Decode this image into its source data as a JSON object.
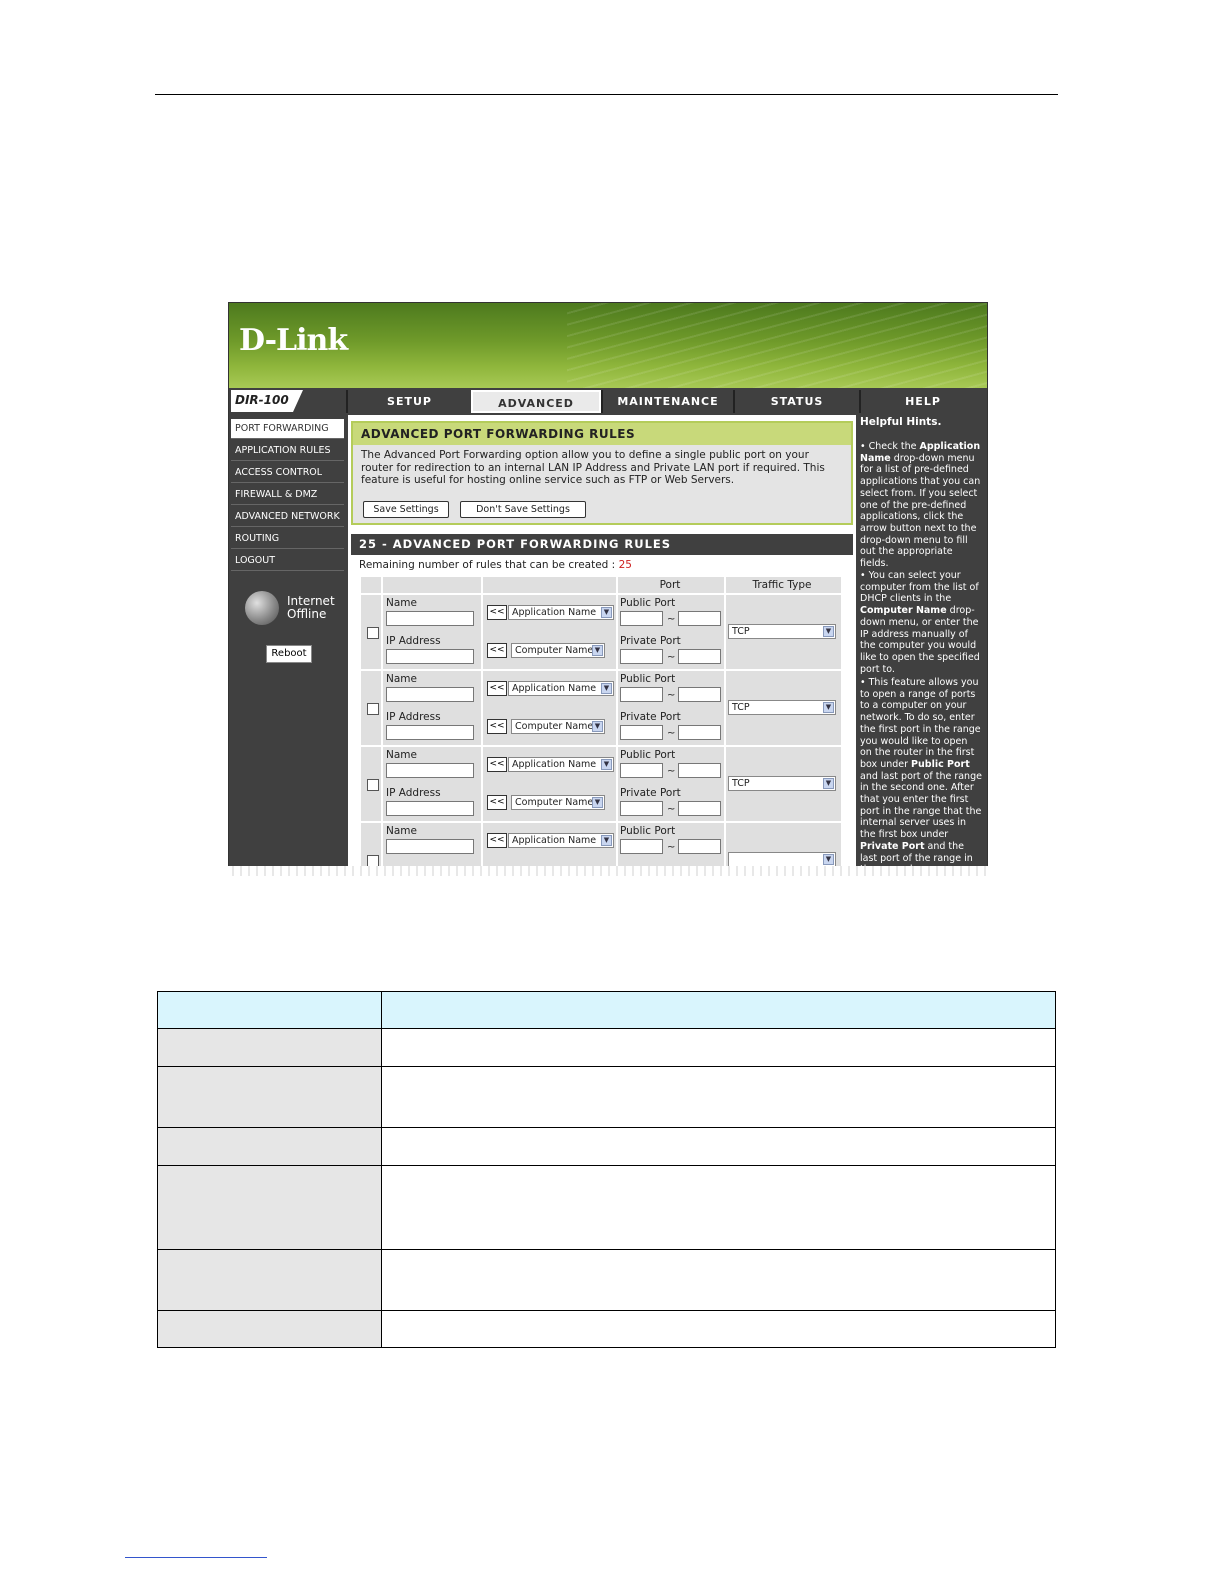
{
  "brand": {
    "logo": "D-Link",
    "model": "DIR-100"
  },
  "nav": {
    "tabs": [
      {
        "label": "SETUP"
      },
      {
        "label": "ADVANCED"
      },
      {
        "label": "MAINTENANCE"
      },
      {
        "label": "STATUS"
      },
      {
        "label": "HELP"
      }
    ],
    "active": "ADVANCED"
  },
  "sidebar": {
    "items": [
      {
        "label": "PORT FORWARDING"
      },
      {
        "label": "APPLICATION RULES"
      },
      {
        "label": "ACCESS CONTROL"
      },
      {
        "label": "FIREWALL & DMZ"
      },
      {
        "label": "ADVANCED NETWORK"
      },
      {
        "label": "ROUTING"
      },
      {
        "label": "LOGOUT"
      }
    ],
    "status_line1": "Internet",
    "status_line2": "Offline",
    "reboot_label": "Reboot"
  },
  "intro": {
    "title": "ADVANCED PORT FORWARDING RULES",
    "description": "The Advanced Port Forwarding option allow you to define a single public port on your router for redirection to an internal LAN IP Address and Private LAN port if required. This feature is useful for hosting online service such as FTP or Web Servers.",
    "save_label": "Save Settings",
    "dont_save_label": "Don't Save Settings"
  },
  "rules": {
    "title": "25 - ADVANCED PORT FORWARDING RULES",
    "remaining_label": "Remaining number of rules that can be created :",
    "remaining_count": "25",
    "headers": {
      "port": "Port",
      "traffic_type": "Traffic Type"
    },
    "labels": {
      "name": "Name",
      "ip_address": "IP Address",
      "public_port": "Public Port",
      "private_port": "Private Port",
      "arrow": "<<",
      "tilde": "~",
      "application_name": "Application Name",
      "computer_name": "Computer Name"
    },
    "rows": [
      {
        "traffic": "TCP"
      },
      {
        "traffic": "TCP"
      },
      {
        "traffic": "TCP"
      },
      {
        "traffic": ""
      }
    ]
  },
  "hints": {
    "title": "Helpful Hints.",
    "hint1_pre": "• Check the ",
    "hint1_bold": "Application Name",
    "hint1_post": " drop-down menu for a list of pre-defined applications that you can select from. If you select one of the pre-defined applications, click the arrow button next to the drop-down menu to fill out the appropriate fields.",
    "hint2_pre": "• You can select your computer from the list of DHCP clients in the ",
    "hint2_bold": "Computer Name",
    "hint2_post": " drop-down menu, or enter the IP address manually of the computer you would like to open the specified port to.",
    "hint3_pre": "• This feature allows you to open a range of ports to a computer on your network. To do so, enter the first port in the range you would like to open on the router in the first box under ",
    "hint3_bold1": "Public Port",
    "hint3_mid": " and last port of the range in the second one. After that you enter the first port in the range that the internal server uses in the first box under ",
    "hint3_bold2": "Private Port",
    "hint3_post": " and the last port of the range in the second."
  },
  "colors": {
    "accent_green": "#6f9a2a",
    "dark_panel": "#404040",
    "table_header": "#d9f5fd",
    "count_red": "#cc2222"
  }
}
